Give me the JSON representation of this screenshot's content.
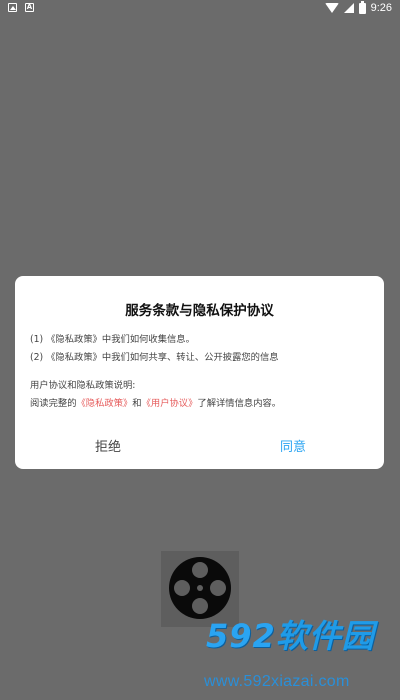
{
  "status_bar": {
    "left_icons": [
      "image-icon",
      "a-icon"
    ],
    "time": "9:26"
  },
  "dialog": {
    "title": "服务条款与隐私保护协议",
    "line1_prefix": "(1) ",
    "line1_link": "《隐私政策》",
    "line1_suffix": "中我们如何收集信息。",
    "line2_prefix": "(2) ",
    "line2_link": "《隐私政策》",
    "line2_suffix": "中我们如何共享、转让、公开披露您的信息",
    "section_heading": "用户协议和隐私政策说明:",
    "read_prefix": "阅读完整的",
    "privacy_link": "《隐私政策》",
    "read_and": "和",
    "user_agreement_link": "《用户协议》",
    "read_suffix": "了解详情信息内容。",
    "reject_label": "拒绝",
    "agree_label": "同意",
    "link_color": "#e65b5b",
    "agree_color": "#2aa4f2"
  },
  "watermark": {
    "logo_num": "592",
    "logo_text": "软件园",
    "url": "www.592xiazai.com"
  }
}
